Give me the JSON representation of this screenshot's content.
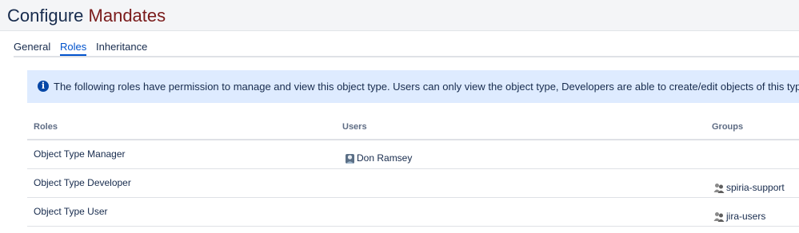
{
  "page": {
    "title_part1": "Configure ",
    "title_part2": "Mandates"
  },
  "tabs": [
    {
      "label": "General",
      "active": false
    },
    {
      "label": "Roles",
      "active": true
    },
    {
      "label": "Inheritance",
      "active": false
    }
  ],
  "info": {
    "icon": "info-icon",
    "text": "The following roles have permission to manage and view this object type. Users can only view the object type, Developers are able to create/edit objects of this type and Managers c"
  },
  "table": {
    "headers": [
      "Roles",
      "Users",
      "Groups"
    ],
    "rows": [
      {
        "role": "Object Type Manager",
        "user": "Don Ramsey",
        "group": ""
      },
      {
        "role": "Object Type Developer",
        "user": "",
        "group": "spiria-support"
      },
      {
        "role": "Object Type User",
        "user": "",
        "group": "jira-users"
      }
    ]
  },
  "colors": {
    "accent": "#0052cc",
    "info_background": "#deebff",
    "title_highlight": "#7a1b1b"
  }
}
